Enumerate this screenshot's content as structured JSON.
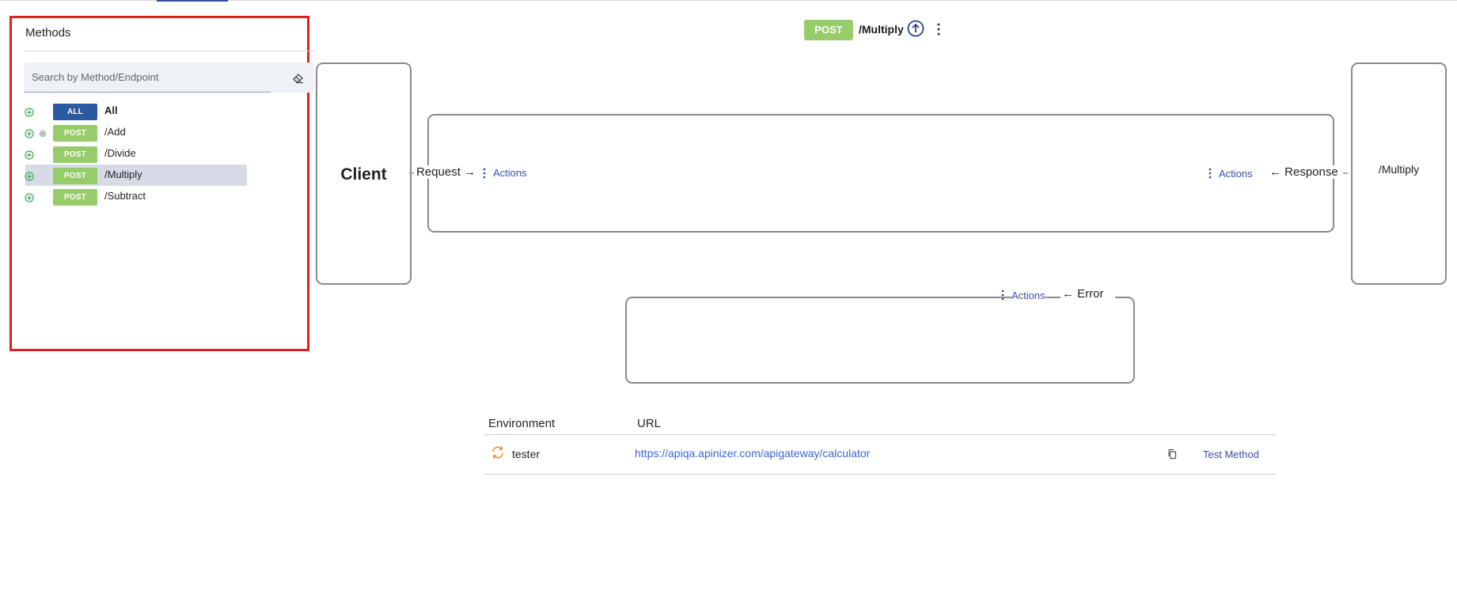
{
  "methods_panel": {
    "title": "Methods",
    "search_placeholder": "Search by Method/Endpoint",
    "items": [
      {
        "badge": "ALL",
        "label": "All"
      },
      {
        "badge": "POST",
        "label": "/Add"
      },
      {
        "badge": "POST",
        "label": "/Divide"
      },
      {
        "badge": "POST",
        "label": "/Multiply"
      },
      {
        "badge": "POST",
        "label": "/Subtract"
      }
    ]
  },
  "header": {
    "method_badge": "POST",
    "endpoint": "/Multiply"
  },
  "flow": {
    "client_label": "Client",
    "request_label": "Request →",
    "response_label": "← Response",
    "error_label": "← Error",
    "actions_label": "Actions",
    "target_label": "/Multiply"
  },
  "environment_table": {
    "headers": {
      "environment": "Environment",
      "url": "URL"
    },
    "rows": [
      {
        "environment": "tester",
        "url": "https://apiqa.apinizer.com/apigateway/calculator",
        "action": "Test Method"
      }
    ]
  },
  "colors": {
    "post_badge": "#96cc6a",
    "all_badge": "#2c5aa0",
    "link": "#3b4fa8",
    "highlight_border": "#e02020"
  }
}
